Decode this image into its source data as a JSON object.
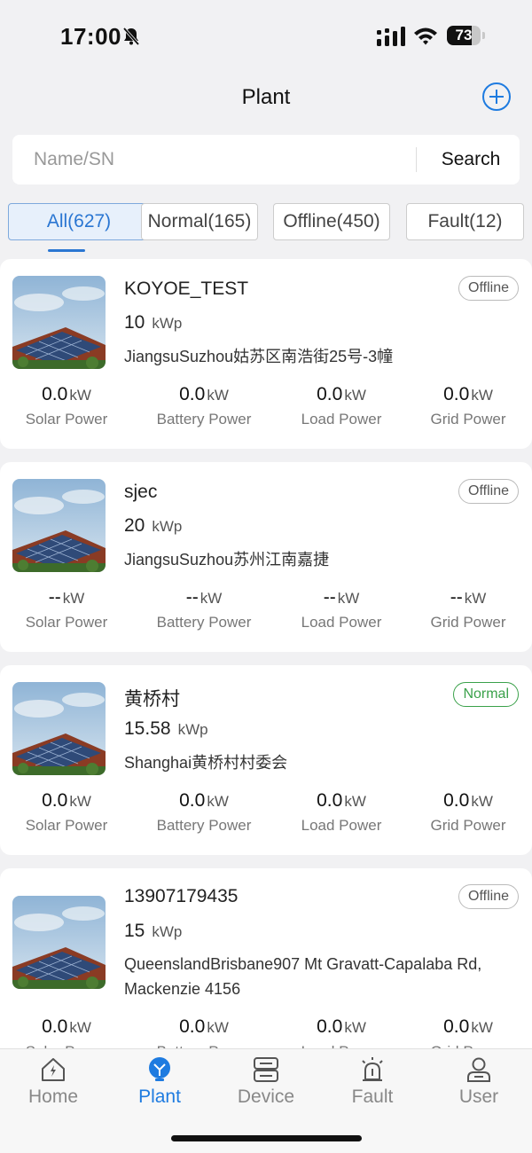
{
  "status_bar": {
    "time": "17:00",
    "battery": "73",
    "battery_level": 0.73
  },
  "header": {
    "title": "Plant"
  },
  "search": {
    "placeholder": "Name/SN",
    "button": "Search"
  },
  "filters": [
    {
      "label": "All(627)",
      "active": true
    },
    {
      "label": "Normal(165)",
      "active": false
    },
    {
      "label": "Offline(450)",
      "active": false
    },
    {
      "label": "Fault(12)",
      "active": false
    }
  ],
  "metric_labels": [
    "Solar Power",
    "Battery Power",
    "Load Power",
    "Grid Power"
  ],
  "plants": [
    {
      "name": "KOYOE_TEST",
      "capacity": "10",
      "capacity_unit": "kWp",
      "address": "JiangsuSuzhou姑苏区南浩街25号-3幢",
      "status": "Offline",
      "metrics": [
        {
          "value": "0.0",
          "unit": "kW"
        },
        {
          "value": "0.0",
          "unit": "kW"
        },
        {
          "value": "0.0",
          "unit": "kW"
        },
        {
          "value": "0.0",
          "unit": "kW"
        }
      ]
    },
    {
      "name": "sjec",
      "capacity": "20",
      "capacity_unit": "kWp",
      "address": "JiangsuSuzhou苏州江南嘉捷",
      "status": "Offline",
      "metrics": [
        {
          "value": "--",
          "unit": "kW"
        },
        {
          "value": "--",
          "unit": "kW"
        },
        {
          "value": "--",
          "unit": "kW"
        },
        {
          "value": "--",
          "unit": "kW"
        }
      ]
    },
    {
      "name": "黄桥村",
      "capacity": "15.58",
      "capacity_unit": "kWp",
      "address": "Shanghai黄桥村村委会",
      "status": "Normal",
      "metrics": [
        {
          "value": "0.0",
          "unit": "kW"
        },
        {
          "value": "0.0",
          "unit": "kW"
        },
        {
          "value": "0.0",
          "unit": "kW"
        },
        {
          "value": "0.0",
          "unit": "kW"
        }
      ]
    },
    {
      "name": "13907179435",
      "capacity": "15",
      "capacity_unit": "kWp",
      "address": "QueenslandBrisbane907 Mt Gravatt-Capalaba Rd, Mackenzie 4156",
      "status": "Offline",
      "metrics": [
        {
          "value": "0.0",
          "unit": "kW"
        },
        {
          "value": "0.0",
          "unit": "kW"
        },
        {
          "value": "0.0",
          "unit": "kW"
        },
        {
          "value": "0.0",
          "unit": "kW"
        }
      ]
    }
  ],
  "tabbar": [
    {
      "label": "Home",
      "icon": "home-icon",
      "active": false
    },
    {
      "label": "Plant",
      "icon": "plant-icon",
      "active": true
    },
    {
      "label": "Device",
      "icon": "device-icon",
      "active": false
    },
    {
      "label": "Fault",
      "icon": "alarm-icon",
      "active": false
    },
    {
      "label": "User",
      "icon": "user-icon",
      "active": false
    }
  ],
  "colors": {
    "accent": "#1e7be0",
    "normal": "#3aa14a",
    "offline": "#555555"
  }
}
